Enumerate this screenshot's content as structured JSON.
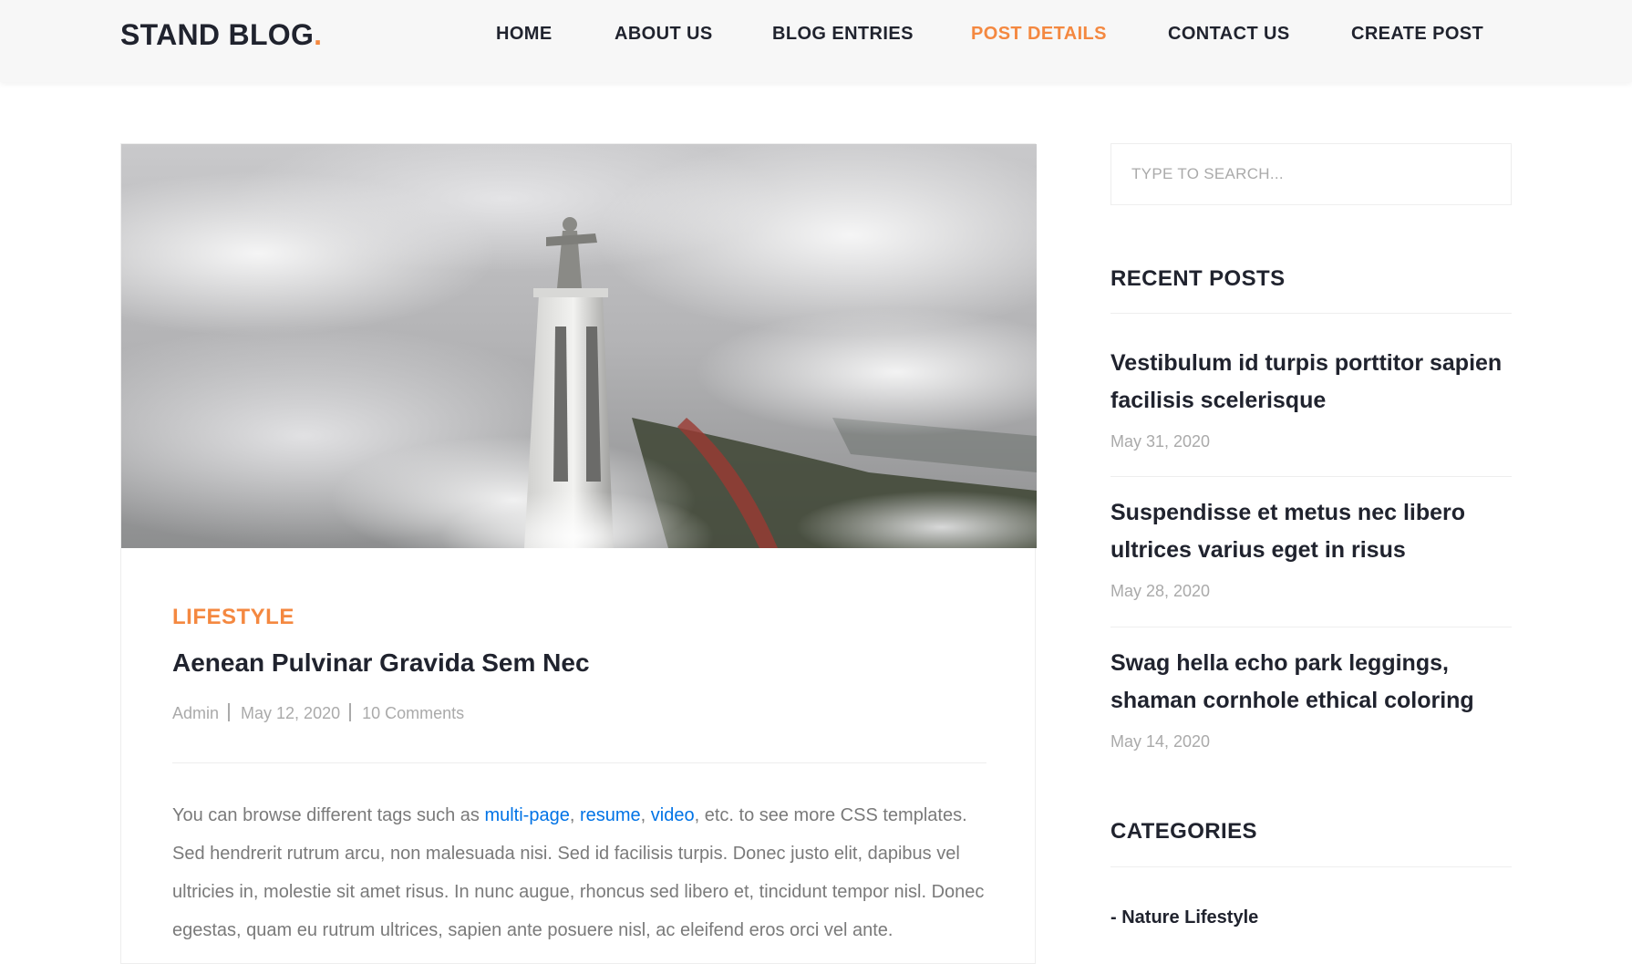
{
  "brand": {
    "name": "STAND BLOG",
    "dot": ".",
    "accent_color": "#f48840"
  },
  "nav": {
    "items": [
      {
        "label": "HOME"
      },
      {
        "label": "ABOUT US"
      },
      {
        "label": "BLOG ENTRIES"
      },
      {
        "label": "POST DETAILS",
        "active": true
      },
      {
        "label": "CONTACT US"
      },
      {
        "label": "CREATE POST"
      }
    ]
  },
  "post": {
    "image_subject": "statue-above-clouds",
    "category": "LIFESTYLE",
    "title": "Aenean Pulvinar Gravida Sem Nec",
    "author": "Admin",
    "date": "May 12, 2020",
    "comments": "10 Comments",
    "body": {
      "intro": "You can browse different tags such as ",
      "tag1": "multi-page",
      "comma1": ", ",
      "tag2": "resume",
      "comma2": ", ",
      "tag3": "video",
      "rest": ", etc. to see more CSS templates. Sed hendrerit rutrum arcu, non malesuada nisi. Sed id facilisis turpis. Donec justo elit, dapibus vel ultricies in, molestie sit amet risus. In nunc augue, rhoncus sed libero et, tincidunt tempor nisl. Donec egestas, quam eu rutrum ultrices, sapien ante posuere nisl, ac eleifend eros orci vel ante."
    }
  },
  "sidebar": {
    "search": {
      "placeholder": "TYPE TO SEARCH..."
    },
    "recent_posts": {
      "title": "RECENT POSTS",
      "items": [
        {
          "title": "Vestibulum id turpis porttitor sapien facilisis scelerisque",
          "date": "May 31, 2020"
        },
        {
          "title": "Suspendisse et metus nec libero ultrices varius eget in risus",
          "date": "May 28, 2020"
        },
        {
          "title": "Swag hella echo park leggings, shaman cornhole ethical coloring",
          "date": "May 14, 2020"
        }
      ]
    },
    "categories": {
      "title": "CATEGORIES",
      "items": [
        {
          "label": "- Nature Lifestyle"
        }
      ]
    }
  }
}
